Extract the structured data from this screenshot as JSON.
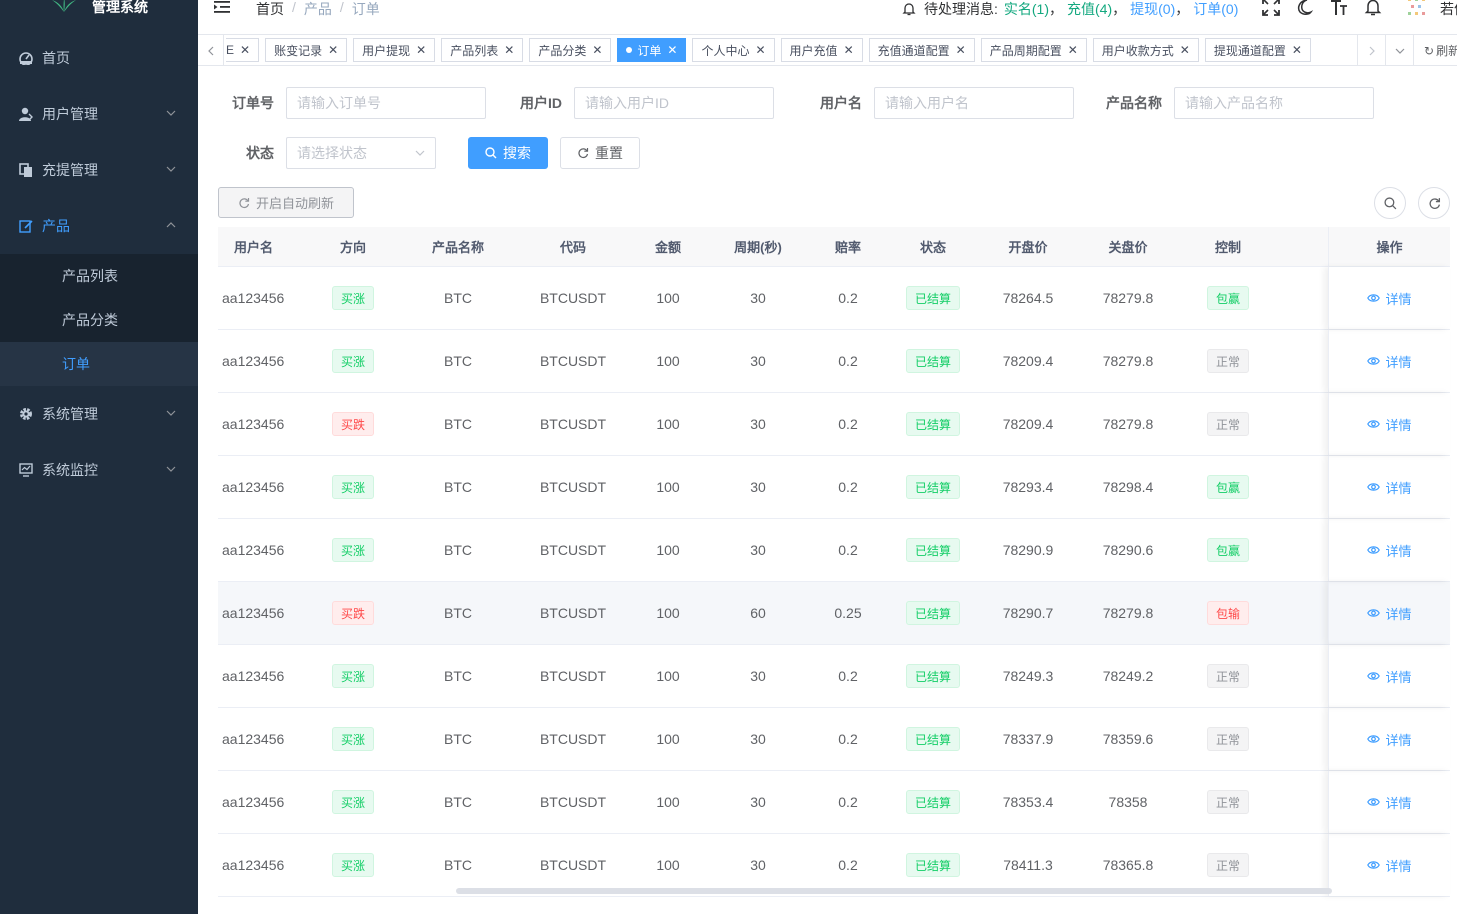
{
  "app": {
    "title": "管理系统"
  },
  "sidebar": {
    "items": [
      {
        "label": "首页",
        "icon": "dashboard-icon"
      },
      {
        "label": "用户管理",
        "icon": "user-icon"
      },
      {
        "label": "充提管理",
        "icon": "copy-icon"
      },
      {
        "label": "产品",
        "icon": "edit-icon"
      },
      {
        "label": "系统管理",
        "icon": "gear-icon"
      },
      {
        "label": "系统监控",
        "icon": "monitor-icon"
      }
    ],
    "sub_items": [
      {
        "label": "产品列表"
      },
      {
        "label": "产品分类"
      },
      {
        "label": "订单"
      }
    ]
  },
  "header": {
    "breadcrumb": [
      "首页",
      "产品",
      "订单"
    ],
    "pending_label": "待处理消息:",
    "pending_links": [
      "实名(1)",
      "充值(4)",
      "提现(0)",
      "订单(0)"
    ],
    "username": "若依"
  },
  "tags": [
    {
      "label": "E"
    },
    {
      "label": "账变记录"
    },
    {
      "label": "用户提现"
    },
    {
      "label": "产品列表"
    },
    {
      "label": "产品分类"
    },
    {
      "label": "订单"
    },
    {
      "label": "个人中心"
    },
    {
      "label": "用户充值"
    },
    {
      "label": "充值通道配置"
    },
    {
      "label": "产品周期配置"
    },
    {
      "label": "用户收款方式"
    },
    {
      "label": "提现通道配置"
    }
  ],
  "tags_refresh": "刷新",
  "filters": {
    "order_no": {
      "label": "订单号",
      "placeholder": "请输入订单号"
    },
    "user_id": {
      "label": "用户ID",
      "placeholder": "请输入用户ID"
    },
    "username": {
      "label": "用户名",
      "placeholder": "请输入用户名"
    },
    "product": {
      "label": "产品名称",
      "placeholder": "请输入产品名称"
    },
    "status": {
      "label": "状态",
      "placeholder": "请选择状态"
    },
    "search_label": "搜索",
    "reset_label": "重置"
  },
  "toolbar": {
    "auto_refresh_label": "开启自动刷新"
  },
  "table": {
    "headers": [
      "用户名",
      "方向",
      "产品名称",
      "代码",
      "金额",
      "周期(秒)",
      "赔率",
      "状态",
      "开盘价",
      "关盘价",
      "控制",
      "操作"
    ],
    "detail_label": "详情",
    "rows": [
      {
        "user": "aa123456",
        "dir": "买涨",
        "dir_type": "green",
        "product": "BTC",
        "code": "BTCUSDT",
        "amount": "100",
        "period": "30",
        "odds": "0.2",
        "status": "已结算",
        "open": "78264.5",
        "close": "78279.8",
        "control": "包赢",
        "control_type": "green"
      },
      {
        "user": "aa123456",
        "dir": "买涨",
        "dir_type": "green",
        "product": "BTC",
        "code": "BTCUSDT",
        "amount": "100",
        "period": "30",
        "odds": "0.2",
        "status": "已结算",
        "open": "78209.4",
        "close": "78279.8",
        "control": "正常",
        "control_type": "gray"
      },
      {
        "user": "aa123456",
        "dir": "买跌",
        "dir_type": "red",
        "product": "BTC",
        "code": "BTCUSDT",
        "amount": "100",
        "period": "30",
        "odds": "0.2",
        "status": "已结算",
        "open": "78209.4",
        "close": "78279.8",
        "control": "正常",
        "control_type": "gray"
      },
      {
        "user": "aa123456",
        "dir": "买涨",
        "dir_type": "green",
        "product": "BTC",
        "code": "BTCUSDT",
        "amount": "100",
        "period": "30",
        "odds": "0.2",
        "status": "已结算",
        "open": "78293.4",
        "close": "78298.4",
        "control": "包赢",
        "control_type": "green"
      },
      {
        "user": "aa123456",
        "dir": "买涨",
        "dir_type": "green",
        "product": "BTC",
        "code": "BTCUSDT",
        "amount": "100",
        "period": "30",
        "odds": "0.2",
        "status": "已结算",
        "open": "78290.9",
        "close": "78290.6",
        "control": "包赢",
        "control_type": "green"
      },
      {
        "user": "aa123456",
        "dir": "买跌",
        "dir_type": "red",
        "product": "BTC",
        "code": "BTCUSDT",
        "amount": "100",
        "period": "60",
        "odds": "0.25",
        "status": "已结算",
        "open": "78290.7",
        "close": "78279.8",
        "control": "包输",
        "control_type": "red"
      },
      {
        "user": "aa123456",
        "dir": "买涨",
        "dir_type": "green",
        "product": "BTC",
        "code": "BTCUSDT",
        "amount": "100",
        "period": "30",
        "odds": "0.2",
        "status": "已结算",
        "open": "78249.3",
        "close": "78249.2",
        "control": "正常",
        "control_type": "gray"
      },
      {
        "user": "aa123456",
        "dir": "买涨",
        "dir_type": "green",
        "product": "BTC",
        "code": "BTCUSDT",
        "amount": "100",
        "period": "30",
        "odds": "0.2",
        "status": "已结算",
        "open": "78337.9",
        "close": "78359.6",
        "control": "正常",
        "control_type": "gray"
      },
      {
        "user": "aa123456",
        "dir": "买涨",
        "dir_type": "green",
        "product": "BTC",
        "code": "BTCUSDT",
        "amount": "100",
        "period": "30",
        "odds": "0.2",
        "status": "已结算",
        "open": "78353.4",
        "close": "78358",
        "control": "正常",
        "control_type": "gray"
      },
      {
        "user": "aa123456",
        "dir": "买涨",
        "dir_type": "green",
        "product": "BTC",
        "code": "BTCUSDT",
        "amount": "100",
        "period": "30",
        "odds": "0.2",
        "status": "已结算",
        "open": "78411.3",
        "close": "78365.8",
        "control": "正常",
        "control_type": "gray"
      }
    ]
  },
  "colors": {
    "sidebar_bg": "#1f2d3d",
    "accent": "#409eff",
    "success": "#13ce66",
    "danger": "#ff4949"
  }
}
